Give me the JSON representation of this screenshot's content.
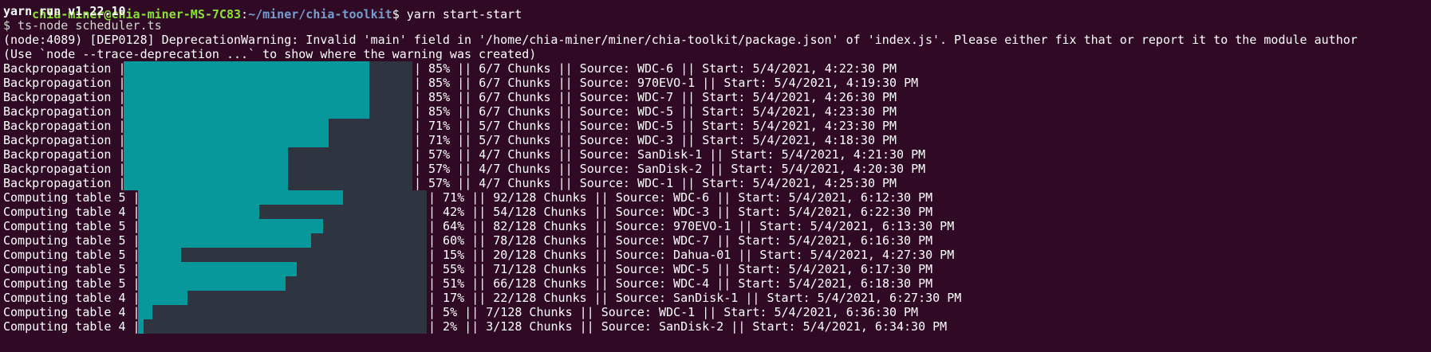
{
  "terminal": {
    "prompt_user_host": "chia-miner@chia-miner-MS-7C83",
    "prompt_sep": ":",
    "prompt_path": "~/miner/chia-toolkit",
    "prompt_dollar": "$",
    "command": "yarn start-start",
    "yarn_version": "yarn run v1.22.10",
    "ts_node": "$ ts-node scheduler.ts",
    "warning_1": "(node:4089) [DEP0128] DeprecationWarning: Invalid 'main' field in '/home/chia-miner/miner/chia-toolkit/package.json' of 'index.js'. Please either fix that or report it to the module author",
    "warning_2": "(Use `node --trace-deprecation ...` to show where the warning was created)",
    "colors": {
      "background": "#300a24",
      "bar_fill": "#06989a",
      "bar_track": "#2e3440"
    }
  },
  "progress_rows": [
    {
      "label": "Backpropagation |",
      "progress": 0.85,
      "suffix": "| 85% || 6/7 Chunks || Source: WDC-6 || Start: 5/4/2021, 4:22:30 PM"
    },
    {
      "label": "Backpropagation |",
      "progress": 0.85,
      "suffix": "| 85% || 6/7 Chunks || Source: 970EVO-1 || Start: 5/4/2021, 4:19:30 PM"
    },
    {
      "label": "Backpropagation |",
      "progress": 0.85,
      "suffix": "| 85% || 6/7 Chunks || Source: WDC-7 || Start: 5/4/2021, 4:26:30 PM"
    },
    {
      "label": "Backpropagation |",
      "progress": 0.85,
      "suffix": "| 85% || 6/7 Chunks || Source: WDC-5 || Start: 5/4/2021, 4:23:30 PM"
    },
    {
      "label": "Backpropagation |",
      "progress": 0.71,
      "suffix": "| 71% || 5/7 Chunks || Source: WDC-5 || Start: 5/4/2021, 4:23:30 PM"
    },
    {
      "label": "Backpropagation |",
      "progress": 0.71,
      "suffix": "| 71% || 5/7 Chunks || Source: WDC-3 || Start: 5/4/2021, 4:18:30 PM"
    },
    {
      "label": "Backpropagation |",
      "progress": 0.57,
      "suffix": "| 57% || 4/7 Chunks || Source: SanDisk-1 || Start: 5/4/2021, 4:21:30 PM"
    },
    {
      "label": "Backpropagation |",
      "progress": 0.57,
      "suffix": "| 57% || 4/7 Chunks || Source: SanDisk-2 || Start: 5/4/2021, 4:20:30 PM"
    },
    {
      "label": "Backpropagation |",
      "progress": 0.57,
      "suffix": "| 57% || 4/7 Chunks || Source: WDC-1 || Start: 5/4/2021, 4:25:30 PM"
    },
    {
      "label": "Computing table 5 |",
      "progress": 0.71,
      "suffix": "| 71% || 92/128 Chunks || Source: WDC-6 || Start: 5/4/2021, 6:12:30 PM"
    },
    {
      "label": "Computing table 4 |",
      "progress": 0.42,
      "suffix": "| 42% || 54/128 Chunks || Source: WDC-3 || Start: 5/4/2021, 6:22:30 PM"
    },
    {
      "label": "Computing table 5 |",
      "progress": 0.64,
      "suffix": "| 64% || 82/128 Chunks || Source: 970EVO-1 || Start: 5/4/2021, 6:13:30 PM"
    },
    {
      "label": "Computing table 5 |",
      "progress": 0.6,
      "suffix": "| 60% || 78/128 Chunks || Source: WDC-7 || Start: 5/4/2021, 6:16:30 PM"
    },
    {
      "label": "Computing table 5 |",
      "progress": 0.15,
      "suffix": "| 15% || 20/128 Chunks || Source: Dahua-01 || Start: 5/4/2021, 4:27:30 PM"
    },
    {
      "label": "Computing table 5 |",
      "progress": 0.55,
      "suffix": "| 55% || 71/128 Chunks || Source: WDC-5 || Start: 5/4/2021, 6:17:30 PM"
    },
    {
      "label": "Computing table 5 |",
      "progress": 0.51,
      "suffix": "| 51% || 66/128 Chunks || Source: WDC-4 || Start: 5/4/2021, 6:18:30 PM"
    },
    {
      "label": "Computing table 4 |",
      "progress": 0.17,
      "suffix": "| 17% || 22/128 Chunks || Source: SanDisk-1 || Start: 5/4/2021, 6:27:30 PM"
    },
    {
      "label": "Computing table 4 |",
      "progress": 0.05,
      "suffix": "| 5% || 7/128 Chunks || Source: WDC-1 || Start: 5/4/2021, 6:36:30 PM"
    },
    {
      "label": "Computing table 4 |",
      "progress": 0.02,
      "suffix": "| 2% || 3/128 Chunks || Source: SanDisk-2 || Start: 5/4/2021, 6:34:30 PM"
    }
  ]
}
